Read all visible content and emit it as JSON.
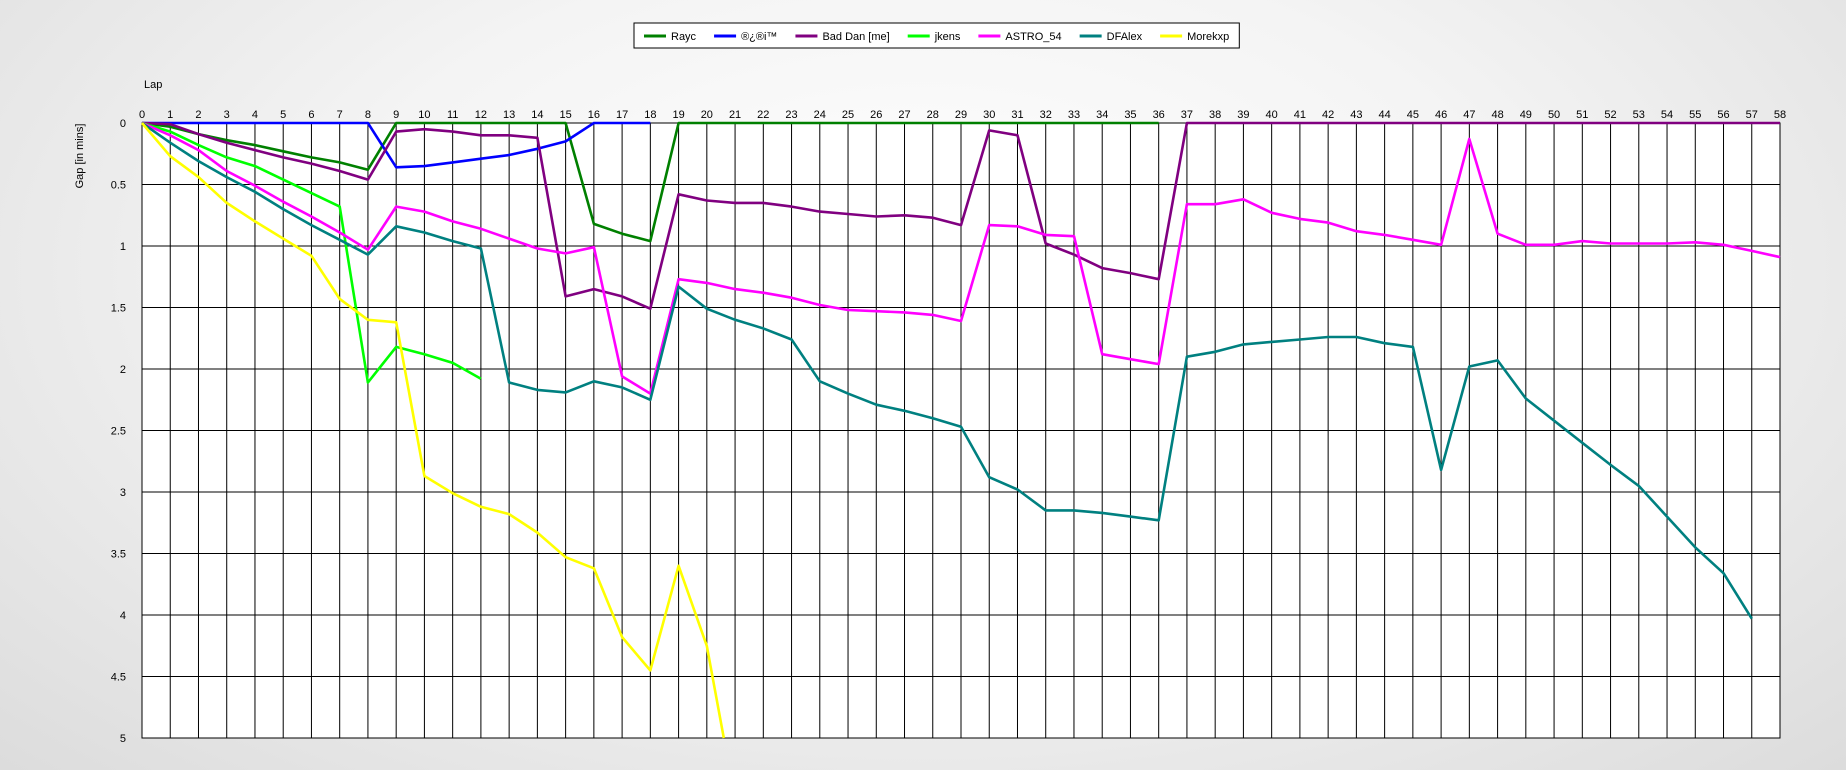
{
  "chart_data": {
    "type": "line",
    "xlabel": "Lap",
    "ylabel": "Gap [in mins]",
    "xlim": [
      0,
      58
    ],
    "ylim": [
      0,
      5
    ],
    "y_inverted": true,
    "grid": true,
    "legend_position": "top-center",
    "x_ticks": [
      0,
      1,
      2,
      3,
      4,
      5,
      6,
      7,
      8,
      9,
      10,
      11,
      12,
      13,
      14,
      15,
      16,
      17,
      18,
      19,
      20,
      21,
      22,
      23,
      24,
      25,
      26,
      27,
      28,
      29,
      30,
      31,
      32,
      33,
      34,
      35,
      36,
      37,
      38,
      39,
      40,
      41,
      42,
      43,
      44,
      45,
      46,
      47,
      48,
      49,
      50,
      51,
      52,
      53,
      54,
      55,
      56,
      57,
      58
    ],
    "y_ticks": [
      0,
      0.5,
      1,
      1.5,
      2,
      2.5,
      3,
      3.5,
      4,
      4.5,
      5
    ],
    "y_tick_labels": [
      "0",
      "0.5",
      "1",
      "1.5",
      "2",
      "2.5",
      "3",
      "3.5",
      "4",
      "4.5",
      "5"
    ],
    "series": [
      {
        "name": "Rayc",
        "color": "#008000",
        "x": [
          0,
          1,
          2,
          3,
          4,
          5,
          6,
          7,
          8,
          9,
          10,
          11,
          12,
          13,
          14,
          15,
          16,
          17,
          18,
          19,
          20,
          21,
          22,
          23,
          24,
          25,
          26,
          27,
          28,
          29,
          30,
          31,
          32,
          33,
          34,
          35,
          36
        ],
        "y": [
          0,
          0.03,
          0.09,
          0.14,
          0.18,
          0.23,
          0.28,
          0.32,
          0.38,
          0,
          0,
          0,
          0,
          0,
          0,
          0,
          0.82,
          0.9,
          0.96,
          0,
          0,
          0,
          0,
          0,
          0,
          0,
          0,
          0,
          0,
          0,
          0,
          0,
          0,
          0,
          0,
          0,
          0
        ]
      },
      {
        "name": "®¿®i™",
        "color": "#0000ff",
        "x": [
          0,
          1,
          2,
          3,
          4,
          5,
          6,
          7,
          8,
          9,
          10,
          11,
          12,
          13,
          14,
          15,
          16,
          17,
          18
        ],
        "y": [
          0,
          0,
          0,
          0,
          0,
          0,
          0,
          0,
          0,
          0.36,
          0.35,
          0.32,
          0.29,
          0.26,
          0.21,
          0.15,
          0,
          0,
          0
        ]
      },
      {
        "name": "Bad Dan [me]",
        "color": "#800080",
        "x": [
          0,
          1,
          2,
          3,
          4,
          5,
          6,
          7,
          8,
          9,
          10,
          11,
          12,
          13,
          14,
          15,
          16,
          17,
          18,
          19,
          20,
          21,
          22,
          23,
          24,
          25,
          26,
          27,
          28,
          29,
          30,
          31,
          32,
          33,
          34,
          35,
          36,
          37,
          38,
          39,
          40,
          41,
          42,
          43,
          44,
          45,
          46,
          47,
          48,
          49,
          50,
          51,
          52,
          53,
          54,
          55,
          56,
          57,
          58
        ],
        "y": [
          0,
          0.01,
          0.09,
          0.16,
          0.22,
          0.28,
          0.33,
          0.39,
          0.46,
          0.07,
          0.05,
          0.07,
          0.1,
          0.1,
          0.12,
          1.41,
          1.35,
          1.41,
          1.51,
          0.58,
          0.63,
          0.65,
          0.65,
          0.68,
          0.72,
          0.74,
          0.76,
          0.75,
          0.77,
          0.83,
          0.06,
          0.1,
          0.98,
          1.07,
          1.18,
          1.22,
          1.27,
          0,
          0,
          0,
          0,
          0,
          0,
          0,
          0,
          0,
          0,
          0,
          0,
          0,
          0,
          0,
          0,
          0,
          0,
          0,
          0,
          0,
          0
        ]
      },
      {
        "name": "jkens",
        "color": "#00ff00",
        "x": [
          0,
          1,
          2,
          3,
          4,
          5,
          6,
          7,
          8,
          9,
          10,
          11,
          12
        ],
        "y": [
          0,
          0.07,
          0.18,
          0.28,
          0.35,
          0.46,
          0.57,
          0.68,
          2.11,
          1.82,
          1.88,
          1.95,
          2.08
        ]
      },
      {
        "name": "ASTRO_54",
        "color": "#ff00ff",
        "x": [
          0,
          1,
          2,
          3,
          4,
          5,
          6,
          7,
          8,
          9,
          10,
          11,
          12,
          13,
          14,
          15,
          16,
          17,
          18,
          19,
          20,
          21,
          22,
          23,
          24,
          25,
          26,
          27,
          28,
          29,
          30,
          31,
          32,
          33,
          34,
          35,
          36,
          37,
          38,
          39,
          40,
          41,
          42,
          43,
          44,
          45,
          46,
          47,
          48,
          49,
          50,
          51,
          52,
          53,
          54,
          55,
          56,
          57,
          58
        ],
        "y": [
          0,
          0.1,
          0.22,
          0.39,
          0.51,
          0.64,
          0.76,
          0.89,
          1.03,
          0.68,
          0.72,
          0.8,
          0.86,
          0.94,
          1.02,
          1.06,
          1.01,
          2.06,
          2.2,
          1.27,
          1.3,
          1.35,
          1.38,
          1.42,
          1.48,
          1.52,
          1.53,
          1.54,
          1.56,
          1.61,
          0.83,
          0.84,
          0.91,
          0.92,
          1.88,
          1.92,
          1.96,
          0.66,
          0.66,
          0.62,
          0.73,
          0.78,
          0.81,
          0.88,
          0.91,
          0.95,
          0.99,
          0.13,
          0.9,
          0.99,
          0.99,
          0.96,
          0.98,
          0.98,
          0.98,
          0.97,
          0.99,
          1.04,
          1.09
        ]
      },
      {
        "name": "DFAlex",
        "color": "#008080",
        "x": [
          0,
          1,
          2,
          3,
          4,
          5,
          6,
          7,
          8,
          9,
          10,
          11,
          12,
          13,
          14,
          15,
          16,
          17,
          18,
          19,
          20,
          21,
          22,
          23,
          24,
          25,
          26,
          27,
          28,
          29,
          30,
          31,
          32,
          33,
          34,
          35,
          36,
          37,
          38,
          39,
          40,
          41,
          42,
          43,
          44,
          45,
          46,
          47,
          48,
          49,
          50,
          51,
          52,
          53,
          54,
          55,
          56,
          57
        ],
        "y": [
          0,
          0.16,
          0.31,
          0.44,
          0.56,
          0.7,
          0.83,
          0.95,
          1.07,
          0.84,
          0.89,
          0.96,
          1.02,
          2.11,
          2.17,
          2.19,
          2.1,
          2.15,
          2.25,
          1.33,
          1.51,
          1.6,
          1.67,
          1.76,
          2.1,
          2.2,
          2.29,
          2.34,
          2.4,
          2.47,
          2.88,
          2.98,
          3.15,
          3.15,
          3.17,
          3.2,
          3.23,
          1.9,
          1.86,
          1.8,
          1.78,
          1.76,
          1.74,
          1.74,
          1.79,
          1.82,
          2.82,
          1.98,
          1.93,
          2.24,
          2.42,
          2.6,
          2.78,
          2.95,
          3.2,
          3.45,
          3.66,
          4.03
        ]
      },
      {
        "name": "Morekxp",
        "color": "#ffff00",
        "x": [
          0,
          1,
          2,
          3,
          4,
          5,
          6,
          7,
          8,
          9,
          10,
          11,
          12,
          13,
          14,
          15,
          16,
          17,
          18,
          19,
          20,
          20.6
        ],
        "y": [
          0,
          0.27,
          0.44,
          0.65,
          0.8,
          0.94,
          1.08,
          1.43,
          1.6,
          1.62,
          2.87,
          3.01,
          3.12,
          3.18,
          3.33,
          3.53,
          3.62,
          4.18,
          4.45,
          3.6,
          4.25,
          5
        ]
      }
    ]
  }
}
